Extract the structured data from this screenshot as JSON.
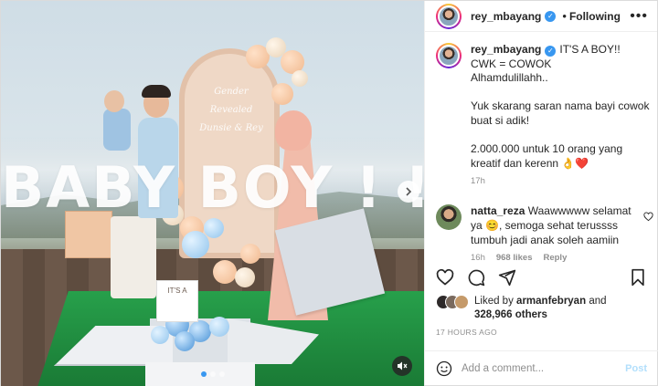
{
  "post": {
    "username": "rey_mbayang",
    "follow_status": "Following",
    "more_icon": "ellipsis-icon",
    "caption": {
      "username": "rey_mbayang",
      "text": "IT'S A BOY!!\nCWK = COWOK\nAlhamdulillahh..\n\nYuk skarang saran nama bayi cowok buat si adik!\n\n2.000.000 untuk 10 orang yang kreatif dan kerenn 👌❤️",
      "time": "17h"
    },
    "comments": [
      {
        "username": "natta_reza",
        "text": "Waawwwww selamat ya 😊, semoga sehat terussss tumbuh jadi anak soleh aamiin",
        "time": "16h",
        "likes": "968 likes",
        "reply": "Reply"
      }
    ],
    "likes": {
      "prefix": "Liked by",
      "user": "armanfebryan",
      "and": "and",
      "others": "328,966 others"
    },
    "posted": "17 HOURS AGO",
    "add_comment": {
      "placeholder": "Add a comment...",
      "post_label": "Post"
    }
  },
  "media": {
    "overlay_text": "BABY BOY ! !",
    "arch_text": "Gender Revealed Dunsie & Rey",
    "sign_text": "IT'S A",
    "carousel_total": 3,
    "carousel_active": 1
  },
  "colors": {
    "accent": "#3897f0",
    "heart": "#e0245e",
    "grass": "#1f8a3e"
  }
}
